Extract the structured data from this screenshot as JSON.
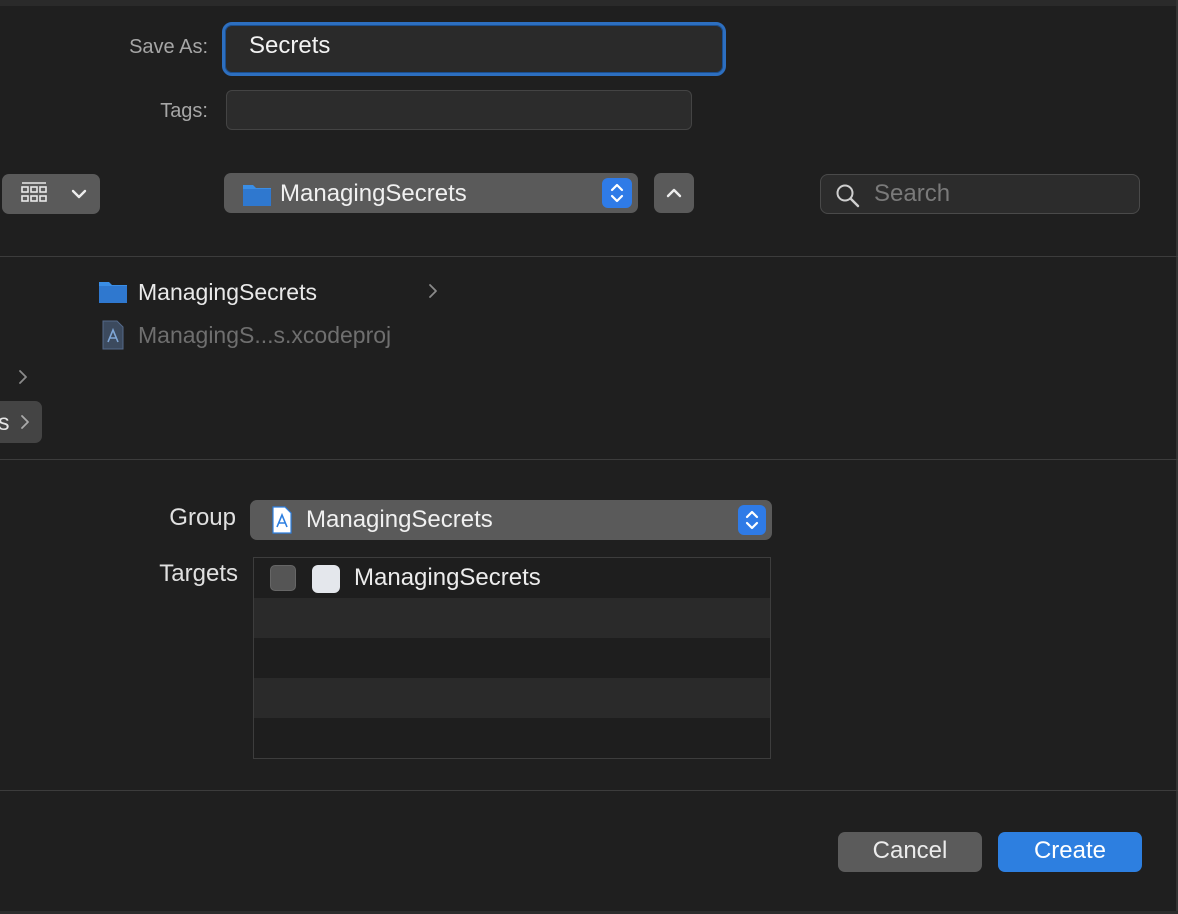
{
  "save_as": {
    "label": "Save As:",
    "value": "Secrets"
  },
  "tags": {
    "label": "Tags:",
    "value": ""
  },
  "toolbar": {
    "location": "ManagingSecrets",
    "search_placeholder": "Search"
  },
  "browser": {
    "items": [
      {
        "name": "ManagingSecrets",
        "type": "folder",
        "enabled": true
      },
      {
        "name": "ManagingS...s.xcodeproj",
        "type": "xcodeproj",
        "enabled": false
      }
    ],
    "partial_sidebar_text": "s"
  },
  "options": {
    "group_label": "Group",
    "group_value": "ManagingSecrets",
    "targets_label": "Targets",
    "targets": [
      {
        "name": "ManagingSecrets",
        "checked": false
      }
    ]
  },
  "buttons": {
    "cancel": "Cancel",
    "create": "Create"
  },
  "colors": {
    "accent": "#2d7fe0",
    "background": "#1f1f1f"
  }
}
